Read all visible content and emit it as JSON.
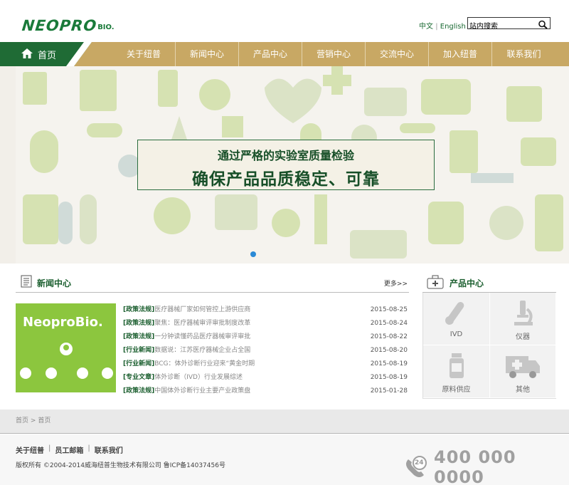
{
  "header": {
    "logo_main": "NEOPRO",
    "logo_sub": "BIO.",
    "lang_zh": "中文",
    "lang_sep": "|",
    "lang_en": "English",
    "search_value": "站内搜索"
  },
  "nav": {
    "home": "首页",
    "items": [
      "关于纽普",
      "新闻中心",
      "产品中心",
      "营销中心",
      "交流中心",
      "加入纽普",
      "联系我们"
    ]
  },
  "banner": {
    "line1": "通过严格的实验室质量检验",
    "line2": "确保产品品质稳定、可靠"
  },
  "news": {
    "title": "新闻中心",
    "more": "更多>>",
    "image_brand": "NeoproBio.",
    "items": [
      {
        "cat": "[政策法规]",
        "text": "医疗器械厂家如何管控上游供应商",
        "date": "2015-08-25"
      },
      {
        "cat": "[政策法规]",
        "text": "聚焦：医疗器械审评审批制度改革",
        "date": "2015-08-24"
      },
      {
        "cat": "[政策法规]",
        "text": "一分钟读懂药品医疗器械审评审批",
        "date": "2015-08-22"
      },
      {
        "cat": "[行业新闻]",
        "text": "数据说：江苏医疗器械企业占全国",
        "date": "2015-08-20"
      },
      {
        "cat": "[行业新闻]",
        "text": "BCG：体外诊断行业迎来“黄金时期",
        "date": "2015-08-19"
      },
      {
        "cat": "[专业文章]",
        "text": "体外诊断（IVD）行业发展综述",
        "date": "2015-08-19"
      },
      {
        "cat": "[政策法规]",
        "text": "中国体外诊断行业主要产业政策盘",
        "date": "2015-01-28"
      }
    ]
  },
  "products": {
    "title": "产品中心",
    "items": [
      {
        "label": "IVD",
        "icon": "test-tube-icon"
      },
      {
        "label": "仪器",
        "icon": "microscope-icon"
      },
      {
        "label": "原料供应",
        "icon": "medicine-bottle-icon"
      },
      {
        "label": "其他",
        "icon": "ambulance-icon"
      }
    ]
  },
  "breadcrumb": {
    "home": "首页",
    "sep": ">",
    "current": "首页"
  },
  "footer": {
    "links": [
      "关于纽普",
      "员工邮箱",
      "联系我们"
    ],
    "copyright": "版权所有 ©2004-2014威海纽普生物技术有限公司 鲁ICP备14037456号",
    "phone": "400 000 0000",
    "phone_badge": "24"
  },
  "colors": {
    "brand_green": "#1a7a3a",
    "nav_gold": "#c8a864",
    "dark_green": "#1a5e2e",
    "dot_blue": "#2a8ad6"
  }
}
